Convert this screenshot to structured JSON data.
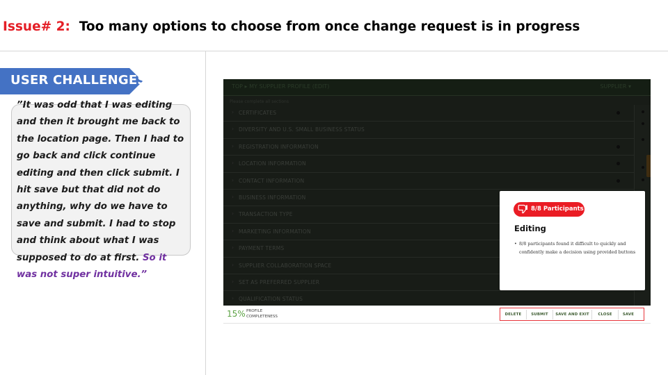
{
  "header": {
    "issue": "Issue# 2:",
    "title": "Too many options to choose from once change request is in progress"
  },
  "section_label": "USER CHALLENGES",
  "quote": {
    "main": "”It was odd that I was editing and then it brought me back to the location page. Then I had to go back and click continue editing and then click submit. I hit save but that did not do anything, why do we have to save and submit. I had to stop and think about what I was supposed to do at first.",
    "emphasis": "So it was not super intuitive.”"
  },
  "screenshot": {
    "breadcrumb": "TOP ▸ MY SUPPLIER PROFILE (EDIT)",
    "top_right": "SUPPLIER ▾",
    "subheading": "Please complete all sections",
    "sections": [
      "CERTIFICATES",
      "DIVERSITY AND U.S. SMALL BUSINESS STATUS",
      "REGISTRATION INFORMATION",
      "LOCATION INFORMATION",
      "CONTACT INFORMATION",
      "BUSINESS INFORMATION",
      "TRANSACTION TYPE",
      "MARKETING INFORMATION",
      "PAYMENT TERMS",
      "SUPPLIER COLLABORATION SPACE",
      "SET AS PREFERRED SUPPLIER",
      "QUALIFICATION STATUS"
    ],
    "completeness": {
      "percent": "15%",
      "label_line1": "PROFILE",
      "label_line2": "COMPLETENESS"
    },
    "buttons": [
      "DELETE",
      "SUBMIT",
      "SAVE AND EXIT",
      "CLOSE",
      "SAVE"
    ]
  },
  "finding": {
    "badge": "8/8 Participants",
    "title": "Editing",
    "bullet": "8/8 participants found it difficult to quickly and confidently make a decision using provided buttons"
  },
  "colors": {
    "accent_red": "#e41e26",
    "tag_blue": "#4472c4",
    "quote_purple": "#7030a0",
    "completeness_green": "#5ba243",
    "button_text_green": "#3e5d32"
  }
}
